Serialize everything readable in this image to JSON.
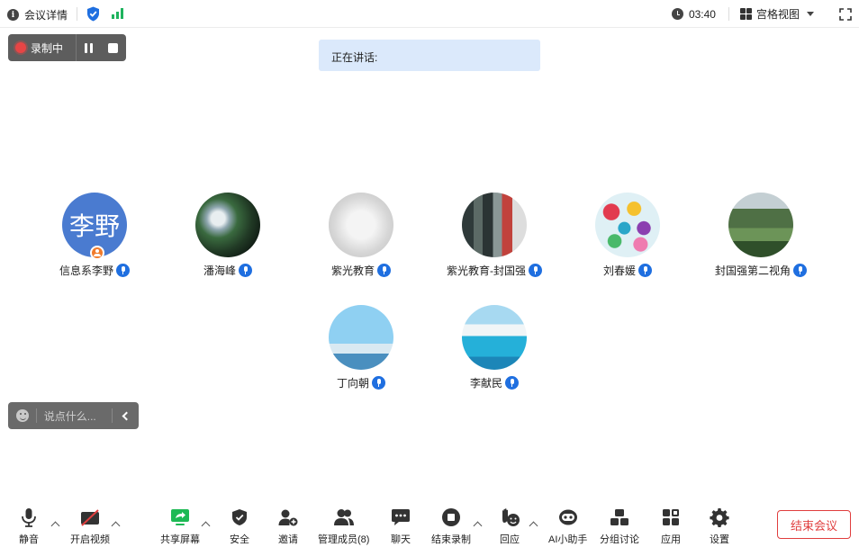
{
  "topbar": {
    "meeting_info_label": "会议详情",
    "timer": "03:40",
    "view_label": "宫格视图"
  },
  "recording": {
    "status_label": "录制中"
  },
  "speaking": {
    "label": "正在讲话:"
  },
  "participants": [
    {
      "name": "信息系李野",
      "avatar_text": "李野",
      "avatar": "text",
      "host": true
    },
    {
      "name": "潘海峰",
      "avatar": "planet-photo"
    },
    {
      "name": "紫光教育",
      "avatar": "robot-photo"
    },
    {
      "name": "紫光教育-封国强",
      "avatar": "room-photo"
    },
    {
      "name": "刘春媛",
      "avatar": "balloon-photo"
    },
    {
      "name": "封国强第二视角",
      "avatar": "lake-photo"
    },
    {
      "name": "丁向朝",
      "avatar": "tower-photo"
    },
    {
      "name": "李献民",
      "avatar": "pool-photo"
    }
  ],
  "chat": {
    "placeholder": "说点什么..."
  },
  "toolbar": {
    "mute": "静音",
    "video": "开启视频",
    "share": "共享屏幕",
    "security": "安全",
    "invite": "邀请",
    "members": "管理成员(8)",
    "chat": "聊天",
    "end_recording": "结束录制",
    "reactions": "回应",
    "ai_assistant": "AI小助手",
    "breakout": "分组讨论",
    "apps": "应用",
    "settings": "设置",
    "end_meeting": "结束会议"
  },
  "colors": {
    "accent_blue": "#1f6fe0",
    "avatar_blue": "#4a7bd0",
    "recording_red": "#e64545",
    "end_red": "#e03e3e",
    "signal_green": "#1fb35e",
    "share_green": "#1db954",
    "speaking_bg": "#dbe9fb"
  }
}
